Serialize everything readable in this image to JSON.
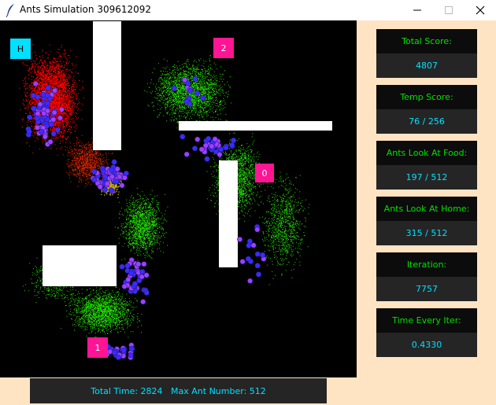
{
  "window": {
    "title": "Ants Simulation 309612092",
    "icon": "feather-icon"
  },
  "simulation": {
    "home_label": "H",
    "food_sources": [
      {
        "label": "0"
      },
      {
        "label": "1"
      },
      {
        "label": "2"
      }
    ],
    "colors": {
      "home": "#00e0ff",
      "food": "#ff1493",
      "home_pheromone": "#ff0000",
      "food_pheromone": "#22dd00",
      "ant_blue": "#3a2cff",
      "ant_purple": "#a040ff",
      "wall": "#ffffff"
    }
  },
  "stats": [
    {
      "label": "Total Score:",
      "value": "4807"
    },
    {
      "label": "Temp Score:",
      "value": "76 / 256"
    },
    {
      "label": "Ants Look At Food:",
      "value": "197 / 512"
    },
    {
      "label": "Ants Look At Home:",
      "value": "315 / 512"
    },
    {
      "label": "Iteration:",
      "value": "7757"
    },
    {
      "label": "Time Every Iter:",
      "value": "0.4330"
    }
  ],
  "footer": {
    "text": "Total Time: 2824   Max Ant Number: 512"
  },
  "colors": {
    "background": "#ffe4c4",
    "panel_head_bg": "#0c0c0c",
    "panel_value_bg": "#252525",
    "label_color": "#00e000",
    "value_color": "#00e0ff"
  }
}
